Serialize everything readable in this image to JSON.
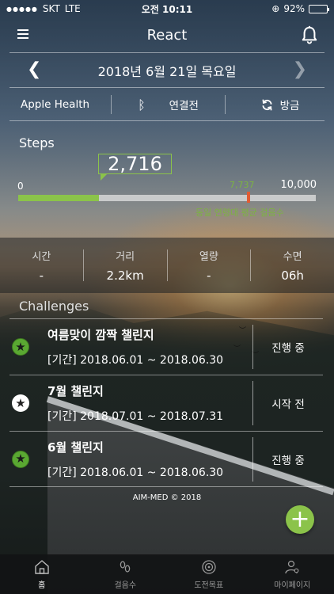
{
  "status_bar": {
    "carrier": "SKT",
    "network": "LTE",
    "time": "오전 10:11",
    "battery": "92%",
    "battery_level": 0.92
  },
  "header": {
    "title": "React",
    "menu_icon": "hamburger-menu-icon",
    "bell_icon": "bell-icon"
  },
  "date_nav": {
    "date": "2018년 6월 21일 목요일",
    "prev_icon": "chevron-left-icon",
    "next_icon": "chevron-right-icon"
  },
  "health": {
    "source": "Apple Health",
    "status": "연결전",
    "sync": "방금",
    "bluetooth_icon": "bluetooth-icon",
    "sync_icon": "sync-icon"
  },
  "steps": {
    "label": "Steps",
    "count": "2,716",
    "count_value": 2716,
    "min": "0",
    "max": "10,000",
    "max_value": 10000,
    "avg": "7,737",
    "avg_value": 7737,
    "avg_label": "동일 연령대 평균 걸음수",
    "colors": {
      "fill": "#8bc34a",
      "track": "#c9cbcb",
      "marker": "#e25c33"
    }
  },
  "stats": [
    {
      "label": "시간",
      "value": "-"
    },
    {
      "label": "거리",
      "value": "2.2km"
    },
    {
      "label": "열량",
      "value": "-"
    },
    {
      "label": "수면",
      "value": "06h"
    }
  ],
  "challenges": {
    "title": "Challenges",
    "items": [
      {
        "name": "여름맞이 깜짝 챌린지",
        "period": "[기간] 2018.06.01 ~ 2018.06.30",
        "status": "진행 중",
        "badge": "green"
      },
      {
        "name": "7월 챌린지",
        "period": "[기간] 2018.07.01 ~ 2018.07.31",
        "status": "시작 전",
        "badge": "white"
      },
      {
        "name": "6월 챌린지",
        "period": "[기간] 2018.06.01 ~ 2018.06.30",
        "status": "진행 중",
        "badge": "green"
      }
    ]
  },
  "footer": {
    "copyright": "AIM-MED © 2018"
  },
  "fab": {
    "icon": "plus-icon",
    "symbol": "+"
  },
  "tabs": [
    {
      "label": "홈",
      "icon": "home-icon",
      "active": true
    },
    {
      "label": "걸음수",
      "icon": "footprints-icon",
      "active": false
    },
    {
      "label": "도전목표",
      "icon": "target-icon",
      "active": false
    },
    {
      "label": "마이페이지",
      "icon": "user-settings-icon",
      "active": false
    }
  ]
}
